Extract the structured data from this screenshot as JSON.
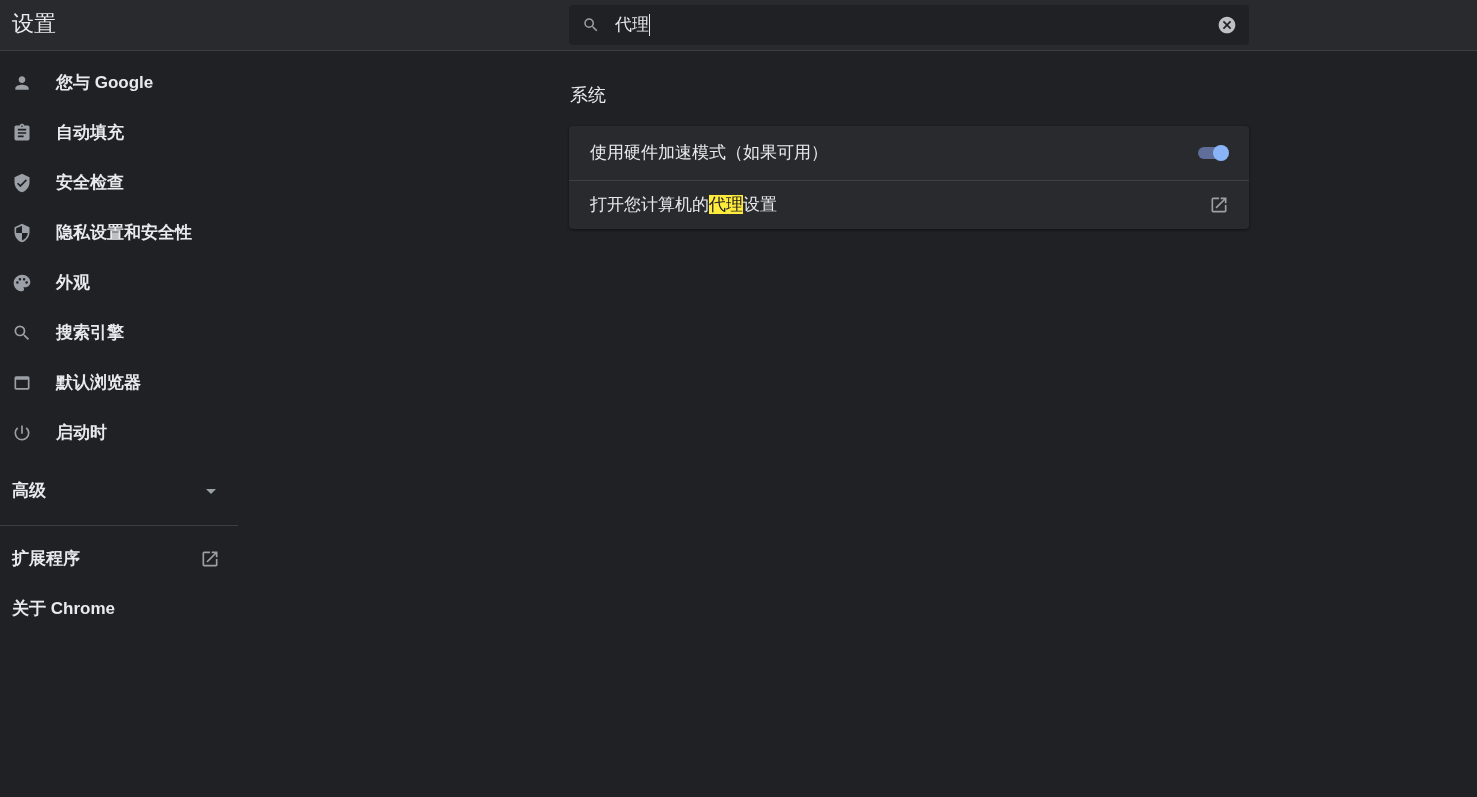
{
  "header": {
    "title": "设置",
    "search": {
      "value": "代理"
    }
  },
  "sidebar": {
    "items": [
      {
        "label": "您与 Google"
      },
      {
        "label": "自动填充"
      },
      {
        "label": "安全检查"
      },
      {
        "label": "隐私设置和安全性"
      },
      {
        "label": "外观"
      },
      {
        "label": "搜索引擎"
      },
      {
        "label": "默认浏览器"
      },
      {
        "label": "启动时"
      }
    ],
    "advanced": {
      "label": "高级",
      "expanded": false
    },
    "links": [
      {
        "label": "扩展程序",
        "external": true
      },
      {
        "label": "关于 Chrome",
        "external": false
      }
    ]
  },
  "main": {
    "section_title": "系统",
    "rows": [
      {
        "kind": "toggle",
        "label": "使用硬件加速模式（如果可用）",
        "on": true
      },
      {
        "kind": "link",
        "external": true,
        "label_parts": [
          {
            "text": "打开您计算机的",
            "highlighted": false
          },
          {
            "text": "代理",
            "highlighted": true
          },
          {
            "text": "设置",
            "highlighted": false
          }
        ]
      }
    ]
  }
}
